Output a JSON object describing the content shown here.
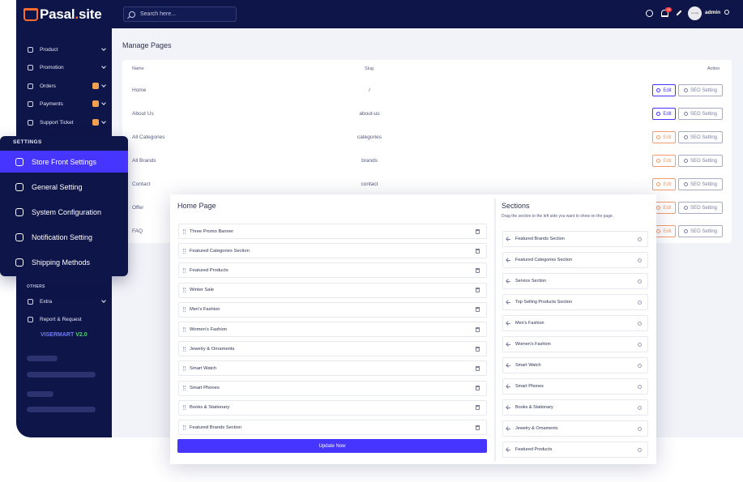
{
  "brand": {
    "logo_main": "Pasal",
    "logo_dot": ".",
    "logo_tail": "site"
  },
  "topbar": {
    "search_placeholder": "Search here...",
    "notification_count": "10",
    "avatar_text": "no-img",
    "user": "admin"
  },
  "sidebar": {
    "items": [
      {
        "label": "Product",
        "icon": "product-icon",
        "badge": false
      },
      {
        "label": "Promotion",
        "icon": "megaphone-icon",
        "badge": false
      },
      {
        "label": "Orders",
        "icon": "orders-icon",
        "badge": true
      },
      {
        "label": "Payments",
        "icon": "payments-icon",
        "badge": true
      },
      {
        "label": "Support Ticket",
        "icon": "ticket-icon",
        "badge": true
      }
    ],
    "others_heading": "OTHERS",
    "others": [
      {
        "label": "Extra",
        "icon": "extra-icon"
      },
      {
        "label": "Report & Request",
        "icon": "report-icon"
      }
    ],
    "version_name": "VISERMART",
    "version_number": "V2.0"
  },
  "settings_menu": {
    "heading": "SETTINGS",
    "items": [
      {
        "label": "Store Front Settings",
        "icon": "store-front-icon",
        "active": true
      },
      {
        "label": "General Setting",
        "icon": "gear-icon",
        "active": false
      },
      {
        "label": "System Configuration",
        "icon": "tools-icon",
        "active": false
      },
      {
        "label": "Notification Setting",
        "icon": "bell-icon",
        "active": false
      },
      {
        "label": "Shipping Methods",
        "icon": "truck-icon",
        "active": false
      }
    ]
  },
  "manage_pages": {
    "title": "Manage Pages",
    "headers": {
      "name": "Name",
      "slug": "Slug",
      "action": "Action"
    },
    "edit_label": "Edit",
    "seo_label": "SEO Setting",
    "rows": [
      {
        "name": "Home",
        "slug": "/",
        "editable": true
      },
      {
        "name": "About Us",
        "slug": "about-us",
        "editable": true
      },
      {
        "name": "All Categories",
        "slug": "categories",
        "editable": false
      },
      {
        "name": "All Brands",
        "slug": "brands",
        "editable": false
      },
      {
        "name": "Contact",
        "slug": "contact",
        "editable": false
      },
      {
        "name": "Offer",
        "slug": "",
        "editable": false
      },
      {
        "name": "FAQ",
        "slug": "",
        "editable": false
      }
    ]
  },
  "home_page": {
    "title": "Home Page",
    "items": [
      "Three Promo Banner",
      "Featured Categories Section",
      "Featured Products",
      "Winter Sale",
      "Men's Fashion",
      "Women's Fashion",
      "Jewelry & Ornaments",
      "Smart Watch",
      "Smart Phones",
      "Books & Stationary",
      "Featured Brands Section"
    ],
    "update_label": "Update Now"
  },
  "sections": {
    "title": "Sections",
    "subtitle": "Drag the section to the left side you want to show on the page.",
    "items": [
      "Featured Brands Section",
      "Featured Categories Section",
      "Service Section",
      "Top Selling Products Section",
      "Men's Fashion",
      "Women's Fashion",
      "Smart Watch",
      "Smart Phones",
      "Books & Stationary",
      "Jewelry & Ornaments",
      "Featured Products"
    ]
  },
  "colors": {
    "navy": "#0e1548",
    "accent": "#4634ff",
    "orange": "#ff6b2c",
    "green": "#4fd17c"
  }
}
